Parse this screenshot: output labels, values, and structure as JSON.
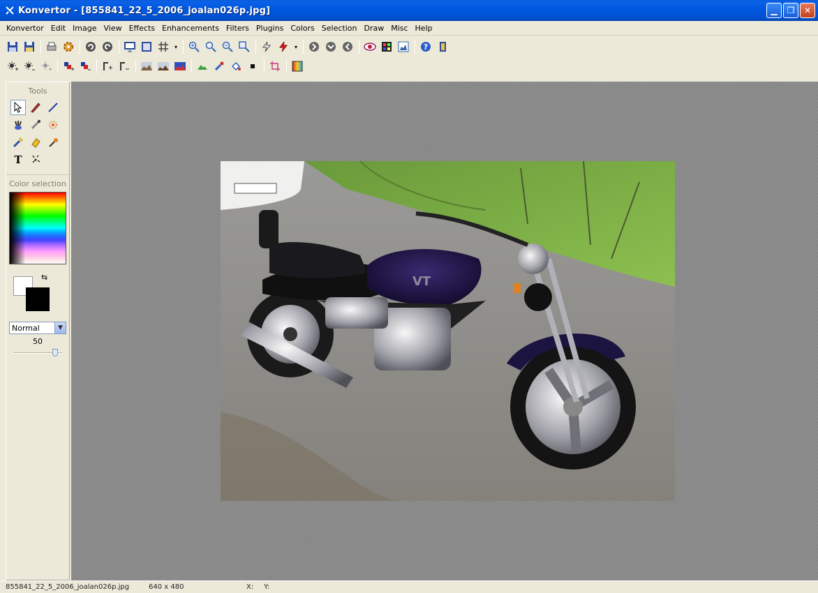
{
  "window": {
    "app_icon": "konvertor-icon",
    "title": "Konvertor - [855841_22_5_2006_joalan026p.jpg]",
    "buttons": [
      "minimize-icon",
      "restore-icon",
      "close-icon"
    ]
  },
  "menu": [
    "Konvertor",
    "Edit",
    "Image",
    "View",
    "Effects",
    "Enhancements",
    "Filters",
    "Plugins",
    "Colors",
    "Selection",
    "Draw",
    "Misc",
    "Help"
  ],
  "tools_panel": {
    "title": "Tools",
    "color_title": "Color selection",
    "blend_mode": "Normal",
    "opacity": "50",
    "opacity_fraction": 0.9,
    "foreground_color": "#ffffff",
    "background_color": "#000000"
  },
  "status": {
    "filename": "855841_22_5_2006_joalan026p.jpg",
    "dimensions": "640 x 480",
    "x_label": "X:",
    "y_label": "Y:"
  },
  "colors": {
    "titlebar": "#0058e0",
    "chrome": "#ece9d8",
    "workspace": "#8a8a8a"
  }
}
